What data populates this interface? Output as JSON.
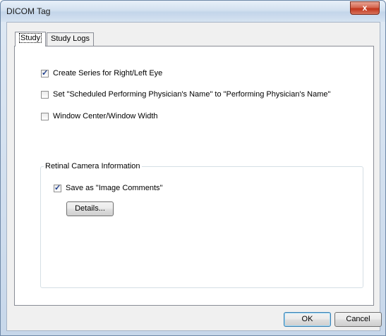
{
  "window": {
    "title": "DICOM Tag",
    "close_label": "x"
  },
  "tabs": [
    {
      "label": "Study",
      "active": true
    },
    {
      "label": "Study Logs",
      "active": false
    }
  ],
  "options": [
    {
      "label": "Create Series for Right/Left Eye",
      "checked": true
    },
    {
      "label": "Set \"Scheduled Performing Physician's Name\" to \"Performing Physician's Name\"",
      "checked": false
    },
    {
      "label": "Window Center/Window Width",
      "checked": false
    }
  ],
  "retinal_group": {
    "title": "Retinal Camera Information",
    "save_as_label": "Save as \"Image Comments\"",
    "save_as_checked": true,
    "details_label": "Details..."
  },
  "footer": {
    "ok_label": "OK",
    "cancel_label": "Cancel"
  }
}
